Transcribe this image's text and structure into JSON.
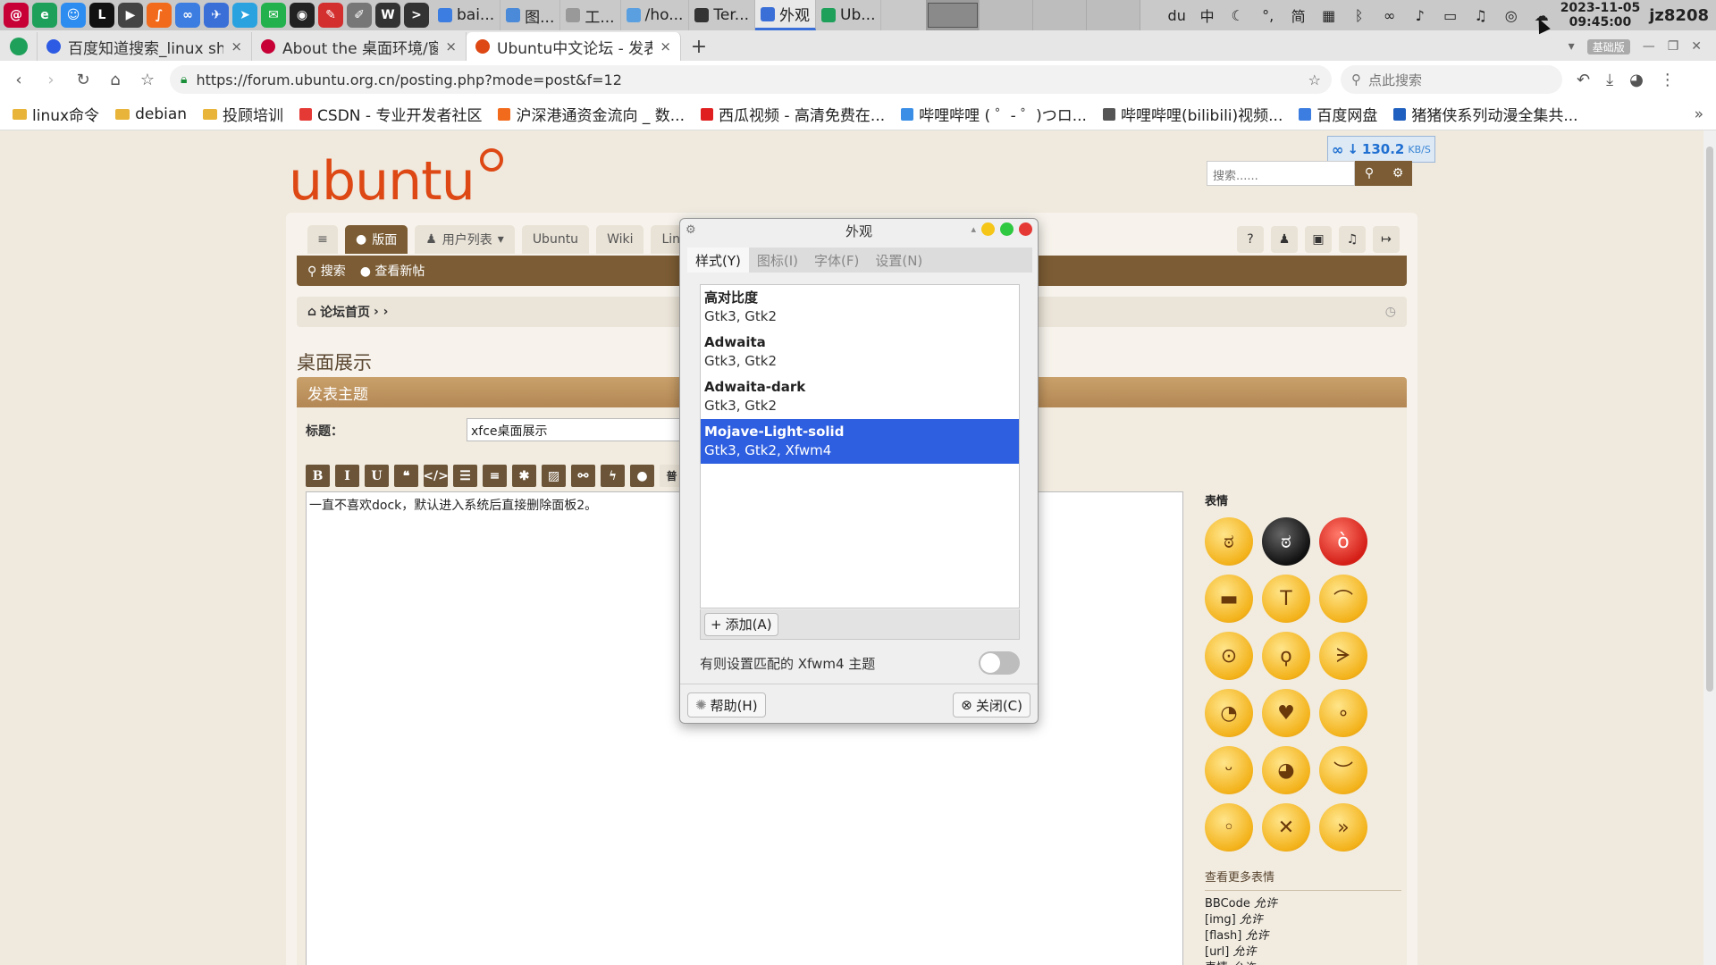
{
  "panel": {
    "launchers": [
      {
        "icon": "debian-swirl-icon",
        "glyph": "@",
        "color": "#c70036"
      },
      {
        "icon": "edge-icon",
        "glyph": "e",
        "color": "#1fa05a"
      },
      {
        "icon": "finder-icon",
        "glyph": "☺",
        "color": "#2d8cf0"
      },
      {
        "icon": "letter-l-icon",
        "glyph": "L",
        "color": "#111111"
      },
      {
        "icon": "clapper-icon",
        "glyph": "▶",
        "color": "#444444"
      },
      {
        "icon": "sublime-icon",
        "glyph": "∫",
        "color": "#f26a1b"
      },
      {
        "icon": "baidu-netdisk-icon",
        "glyph": "∞",
        "color": "#3b7de0"
      },
      {
        "icon": "bird-icon",
        "glyph": "✈",
        "color": "#3a6fd8"
      },
      {
        "icon": "telegram-icon",
        "glyph": "➤",
        "color": "#2aa2e0"
      },
      {
        "icon": "wechat-icon",
        "glyph": "✉",
        "color": "#22b14c"
      },
      {
        "icon": "qq-penguin-icon",
        "glyph": "◉",
        "color": "#222222"
      },
      {
        "icon": "pdf-icon",
        "glyph": "✎",
        "color": "#d32f2f"
      },
      {
        "icon": "text-editor-icon",
        "glyph": "✐",
        "color": "#777777"
      },
      {
        "icon": "wordpress-icon",
        "glyph": "W",
        "color": "#333333"
      },
      {
        "icon": "terminal-icon",
        "glyph": ">",
        "color": "#333333"
      }
    ],
    "tasks": [
      {
        "label": "bai...",
        "icon_color": "#3b7de0",
        "active": false
      },
      {
        "label": "图...",
        "icon_color": "#4a8ad8",
        "active": false
      },
      {
        "label": "工...",
        "icon_color": "#999999",
        "active": false
      },
      {
        "label": "/ho...",
        "icon_color": "#5aa0e0",
        "active": false
      },
      {
        "label": "Ter...",
        "icon_color": "#333333",
        "active": false
      },
      {
        "label": "外观",
        "icon_color": "#3a6fd8",
        "active": true
      },
      {
        "label": "Ub...",
        "icon_color": "#1fa05a",
        "active": false
      }
    ],
    "tray": [
      {
        "icon": "baidu-input-icon",
        "glyph": "du"
      },
      {
        "icon": "chinese-mode-icon",
        "glyph": "中"
      },
      {
        "icon": "moon-icon",
        "glyph": "☾"
      },
      {
        "icon": "punctuation-icon",
        "glyph": "°,"
      },
      {
        "icon": "simplified-icon",
        "glyph": "简"
      },
      {
        "icon": "grid-icon",
        "glyph": "▦"
      },
      {
        "icon": "bluetooth-icon",
        "glyph": "ᛒ"
      },
      {
        "icon": "netdisk-tray-icon",
        "glyph": "∞"
      },
      {
        "icon": "volume-icon",
        "glyph": "♪"
      },
      {
        "icon": "battery-icon",
        "glyph": "▭"
      },
      {
        "icon": "bell-icon",
        "glyph": "♫"
      },
      {
        "icon": "screenshot-icon",
        "glyph": "◎"
      },
      {
        "icon": "weather-icon",
        "glyph": "☁"
      }
    ],
    "date": "2023-11-05",
    "time": "09:45:00",
    "user": "jz8208"
  },
  "browser": {
    "tabs": [
      {
        "label": "百度知道搜索_linux she",
        "fav_color": "#2d5be3",
        "active": false
      },
      {
        "label": "About the 桌面环境/窗",
        "fav_color": "#c70036",
        "active": false
      },
      {
        "label": "Ubuntu中文论坛 - 发表",
        "fav_color": "#dd4814",
        "active": true
      }
    ],
    "tab_close": "×",
    "new_tab": "+",
    "edition": "基础版",
    "url": "https://forum.ubuntu.org.cn/posting.php?mode=post&f=12",
    "search_placeholder": "点此搜索",
    "bookmarks": [
      {
        "label": "linux命令",
        "kind": "folder"
      },
      {
        "label": "debian",
        "kind": "folder"
      },
      {
        "label": "投顾培训",
        "kind": "folder"
      },
      {
        "label": "CSDN - 专业开发者社区",
        "kind": "site",
        "color": "#e53935"
      },
      {
        "label": "沪深港通资金流向 _ 数...",
        "kind": "site",
        "color": "#f26a1b"
      },
      {
        "label": "西瓜视频 - 高清免费在...",
        "kind": "site",
        "color": "#e02020"
      },
      {
        "label": "哔哩哔哩 ( ゜- ゜)つロ...",
        "kind": "site",
        "color": "#3a8ee6"
      },
      {
        "label": "哔哩哔哩(bilibili)视频...",
        "kind": "site",
        "color": "#555555"
      },
      {
        "label": "百度网盘",
        "kind": "site",
        "color": "#3b7de0"
      },
      {
        "label": "猪猪侠系列动漫全集共...",
        "kind": "site",
        "color": "#1f5fbf"
      }
    ],
    "bookmarks_more": "»"
  },
  "site": {
    "logo": "ubuntu",
    "search_placeholder": "搜索......",
    "download_speed": "130.2",
    "download_unit": "KB/S",
    "nav_tabs": [
      {
        "label": "版面",
        "icon": "comment-icon",
        "glyph": "●",
        "selected": true
      },
      {
        "label": "用户列表",
        "icon": "users-icon",
        "glyph": "♟",
        "selected": false
      },
      {
        "label": "Ubuntu",
        "icon": "",
        "glyph": "",
        "selected": false
      },
      {
        "label": "Wiki",
        "icon": "",
        "glyph": "",
        "selected": false
      },
      {
        "label": "Lin",
        "icon": "",
        "glyph": "",
        "selected": false
      }
    ],
    "nav_icons": [
      {
        "icon": "help-icon",
        "glyph": "?"
      },
      {
        "icon": "user-icon",
        "glyph": "♟"
      },
      {
        "icon": "inbox-icon",
        "glyph": "▣"
      },
      {
        "icon": "notification-bell-icon",
        "glyph": "♫"
      },
      {
        "icon": "logout-icon",
        "glyph": "↦"
      }
    ],
    "subnav": [
      {
        "label": "搜索",
        "icon": "search-icon",
        "glyph": "⚲"
      },
      {
        "label": "查看新帖",
        "icon": "comments-icon",
        "glyph": "●"
      }
    ],
    "breadcrumb": "论坛首页",
    "page_title": "桌面展示",
    "post_header": "发表主题",
    "subject_label": "标题：",
    "subject_value": "xfce桌面展示",
    "bbcode_buttons": [
      "B",
      "I",
      "U",
      "❝",
      "</>",
      "☰",
      "≡",
      "✱",
      "▨",
      "⚯",
      "ϟ",
      "●",
      "普"
    ],
    "message": "一直不喜欢dock，默认进入系统后直接删除面板2。",
    "smilies_title": "表情",
    "smilies": [
      {
        "face": "ಠ",
        "tone": "yellow"
      },
      {
        "face": "ಠ",
        "tone": "dark"
      },
      {
        "face": "ò",
        "tone": "red"
      },
      {
        "face": "▬",
        "tone": "yellow"
      },
      {
        "face": "T",
        "tone": "yellow"
      },
      {
        "face": "⌒",
        "tone": "yellow"
      },
      {
        "face": "⊙",
        "tone": "yellow"
      },
      {
        "face": "ϙ",
        "tone": "yellow"
      },
      {
        "face": "ᗒ",
        "tone": "yellow"
      },
      {
        "face": "◔",
        "tone": "yellow"
      },
      {
        "face": "♥",
        "tone": "yellow"
      },
      {
        "face": "∘",
        "tone": "yellow"
      },
      {
        "face": "ᵕ",
        "tone": "yellow"
      },
      {
        "face": "◕",
        "tone": "yellow"
      },
      {
        "face": "︶",
        "tone": "yellow"
      },
      {
        "face": "◦",
        "tone": "yellow"
      },
      {
        "face": "✕",
        "tone": "yellow"
      },
      {
        "face": "»",
        "tone": "yellow"
      }
    ],
    "more_smilies": "查看更多表情",
    "options": [
      {
        "name": "BBCode",
        "state": "允许"
      },
      {
        "name": "[img]",
        "state": "允许"
      },
      {
        "name": "[flash]",
        "state": "允许"
      },
      {
        "name": "[url]",
        "state": "允许"
      },
      {
        "name": "表情",
        "state": "允许"
      }
    ]
  },
  "dialog": {
    "title": "外观",
    "tabs": [
      {
        "label": "样式(Y)",
        "selected": true
      },
      {
        "label": "图标(I)",
        "selected": false
      },
      {
        "label": "字体(F)",
        "selected": false
      },
      {
        "label": "设置(N)",
        "selected": false
      }
    ],
    "themes": [
      {
        "name": "高对比度",
        "desc": "Gtk3, Gtk2",
        "selected": false
      },
      {
        "name": "Adwaita",
        "desc": "Gtk3, Gtk2",
        "selected": false
      },
      {
        "name": "Adwaita-dark",
        "desc": "Gtk3, Gtk2",
        "selected": false
      },
      {
        "name": "Mojave-Light-solid",
        "desc": "Gtk3, Gtk2, Xfwm4",
        "selected": true
      }
    ],
    "add_label": "添加(A)",
    "xfwm_label": "有则设置匹配的 Xfwm4 主题",
    "xfwm_enabled": false,
    "help_label": "帮助(H)",
    "close_label": "关闭(C)",
    "colors": {
      "accent": "#2e5fe0",
      "min": "#f5c518",
      "max": "#2ec940",
      "close": "#e53935"
    }
  }
}
